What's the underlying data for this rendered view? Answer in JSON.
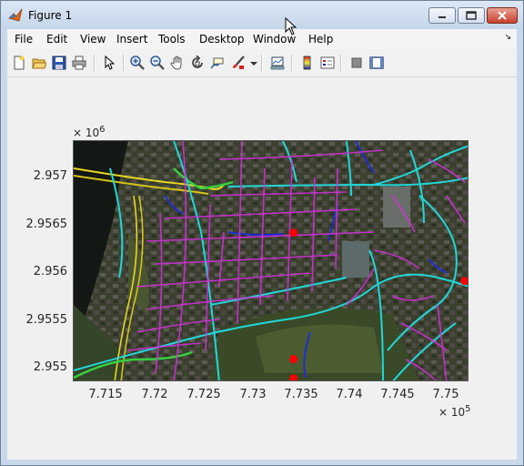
{
  "window": {
    "title": "Figure 1"
  },
  "colors": {
    "accent": "#4a6fa0",
    "close": "#c7402c"
  },
  "menu": [
    "File",
    "Edit",
    "View",
    "Insert",
    "Tools",
    "Desktop",
    "Window",
    "Help"
  ],
  "toolbar": [
    {
      "name": "new-figure-icon"
    },
    {
      "name": "open-file-icon"
    },
    {
      "name": "save-icon"
    },
    {
      "name": "print-icon"
    },
    {
      "name": "pointer-icon"
    },
    {
      "name": "zoom-in-icon"
    },
    {
      "name": "zoom-out-icon"
    },
    {
      "name": "pan-icon"
    },
    {
      "name": "rotate-3d-icon"
    },
    {
      "name": "data-cursor-icon"
    },
    {
      "name": "brush-icon"
    },
    {
      "name": "brush-dropdown-icon"
    },
    {
      "name": "link-plot-icon"
    },
    {
      "name": "colorbar-icon"
    },
    {
      "name": "legend-icon"
    },
    {
      "name": "hide-plot-tools-icon"
    },
    {
      "name": "show-plot-tools-icon"
    }
  ],
  "axes": {
    "y_ticks": [
      "2.957",
      "2.9565",
      "2.956",
      "2.9555",
      "2.955"
    ],
    "x_ticks": [
      "7.715",
      "7.72",
      "7.725",
      "7.73",
      "7.735",
      "7.74",
      "7.745",
      "7.75"
    ],
    "y_exponent_base": "× 10",
    "y_exponent_power": "6",
    "x_exponent_base": "× 10",
    "x_exponent_power": "5"
  },
  "chart_data": {
    "type": "scatter",
    "title": "",
    "xlabel": "",
    "ylabel": "",
    "background": "aerial orthophoto with street network overlay",
    "xlim": [
      771150,
      775200
    ],
    "ylim": [
      2954900,
      2957400
    ],
    "markers": {
      "color": "#ff0000",
      "x": [
        773400,
        775150,
        773400,
        773400
      ],
      "y": [
        2956450,
        2955950,
        2955140,
        2954940
      ]
    }
  }
}
